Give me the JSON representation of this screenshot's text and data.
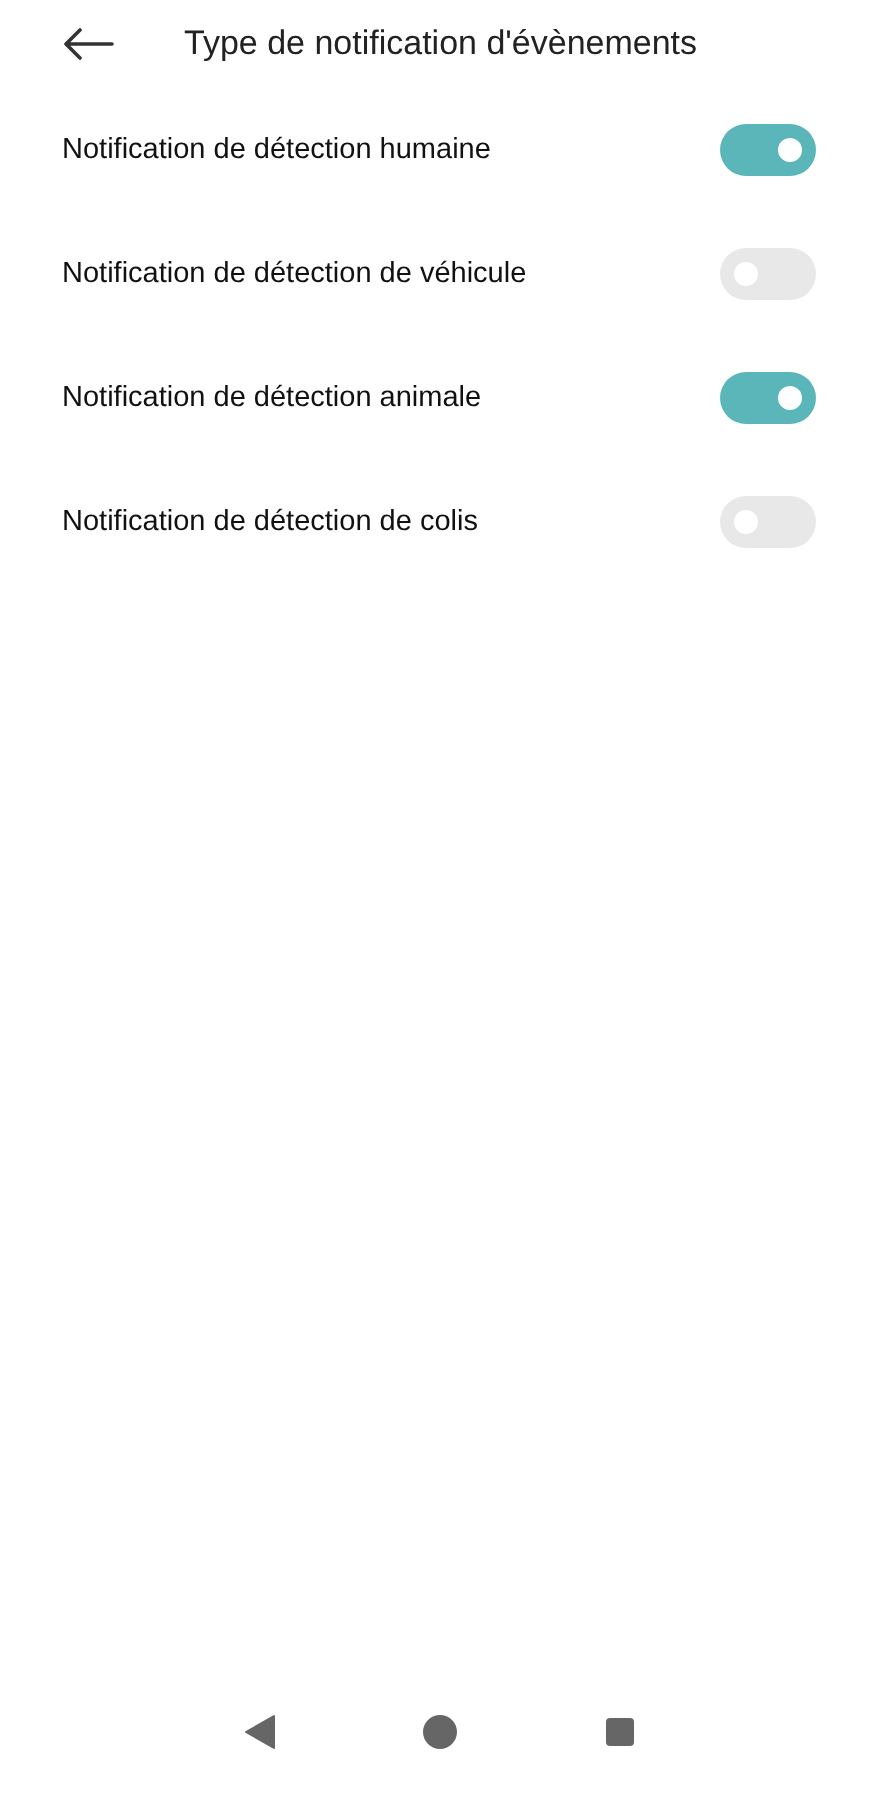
{
  "header": {
    "title": "Type de notification d'évènements"
  },
  "settings": [
    {
      "label": "Notification de détection humaine",
      "on": true
    },
    {
      "label": "Notification de détection de véhicule",
      "on": false
    },
    {
      "label": "Notification de détection animale",
      "on": true
    },
    {
      "label": "Notification de détection de colis",
      "on": false
    }
  ]
}
